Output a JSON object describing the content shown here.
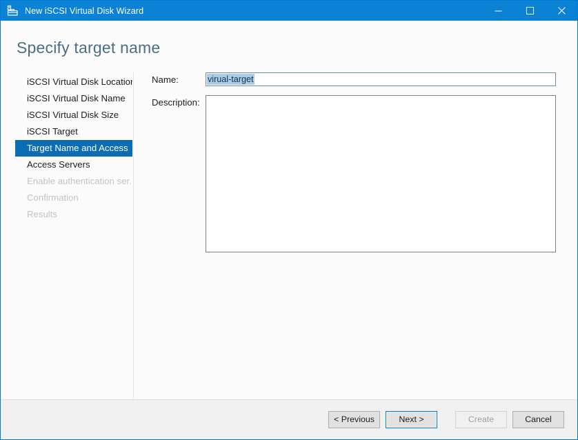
{
  "window": {
    "title": "New iSCSI Virtual Disk Wizard",
    "icon": "iscsi-disk-icon",
    "controls": {
      "minimize": "minimize-icon",
      "maximize": "maximize-icon",
      "close": "close-icon"
    },
    "accent_color": "#0c82d4"
  },
  "page": {
    "heading": "Specify target name"
  },
  "nav": {
    "items": [
      {
        "label": "iSCSI Virtual Disk Location",
        "state": "normal"
      },
      {
        "label": "iSCSI Virtual Disk Name",
        "state": "normal"
      },
      {
        "label": "iSCSI Virtual Disk Size",
        "state": "normal"
      },
      {
        "label": "iSCSI Target",
        "state": "normal"
      },
      {
        "label": "Target Name and Access",
        "state": "selected"
      },
      {
        "label": "Access Servers",
        "state": "normal"
      },
      {
        "label": "Enable authentication ser...",
        "state": "disabled"
      },
      {
        "label": "Confirmation",
        "state": "disabled"
      },
      {
        "label": "Results",
        "state": "disabled"
      }
    ],
    "selected_color": "#0c6db4"
  },
  "form": {
    "name": {
      "label": "Name:",
      "value": "virual-target",
      "placeholder": "",
      "selection_color": "#accbe8"
    },
    "description": {
      "label": "Description:",
      "value": "",
      "placeholder": ""
    }
  },
  "footer": {
    "buttons": [
      {
        "label": "< Previous",
        "state": "normal"
      },
      {
        "label": "Next >",
        "state": "focused"
      },
      {
        "label": "Create",
        "state": "disabled"
      },
      {
        "label": "Cancel",
        "state": "normal"
      }
    ]
  }
}
